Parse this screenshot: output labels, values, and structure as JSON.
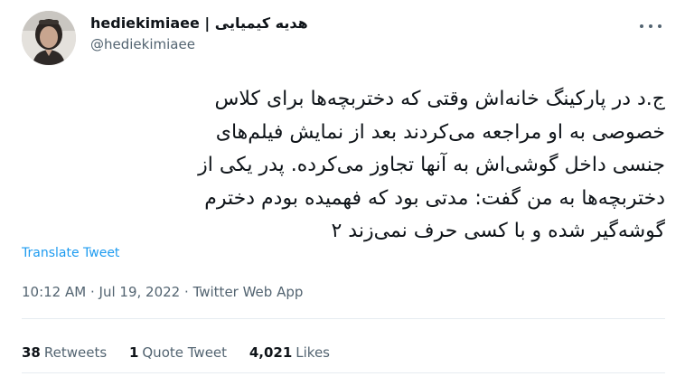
{
  "author": {
    "display_name": "hediekimiaee | هدیه کیمیایی",
    "handle": "@hediekimiaee"
  },
  "tweet": {
    "text": "ج.د در پارکینگ خانه‌اش وقتی که دختربچه‌ها برای کلاس\nخصوصی به او مراجعه می‌کردند بعد از نمایش فیلم‌های\nجنسی داخل گوشی‌اش به آنها تجاوز می‌کرده. پدر یکی از\nدختربچه‌ها به من گفت: مدتی بود که فهمیده بودم دخترم\nگوشه‌گیر شده و با کسی حرف نمی‌زند ۲",
    "translate_label": "Translate Tweet",
    "time": "10:12 AM",
    "date": "Jul 19, 2022",
    "source": "Twitter Web App",
    "separator": "·"
  },
  "stats": {
    "retweets_count": "38",
    "retweets_label": "Retweets",
    "quotes_count": "1",
    "quotes_label": "Quote Tweet",
    "likes_count": "4,021",
    "likes_label": "Likes"
  },
  "icons": {
    "more": "more-options-icon"
  },
  "colors": {
    "link": "#1d9bf0",
    "muted": "#536471",
    "text": "#0f1419"
  }
}
